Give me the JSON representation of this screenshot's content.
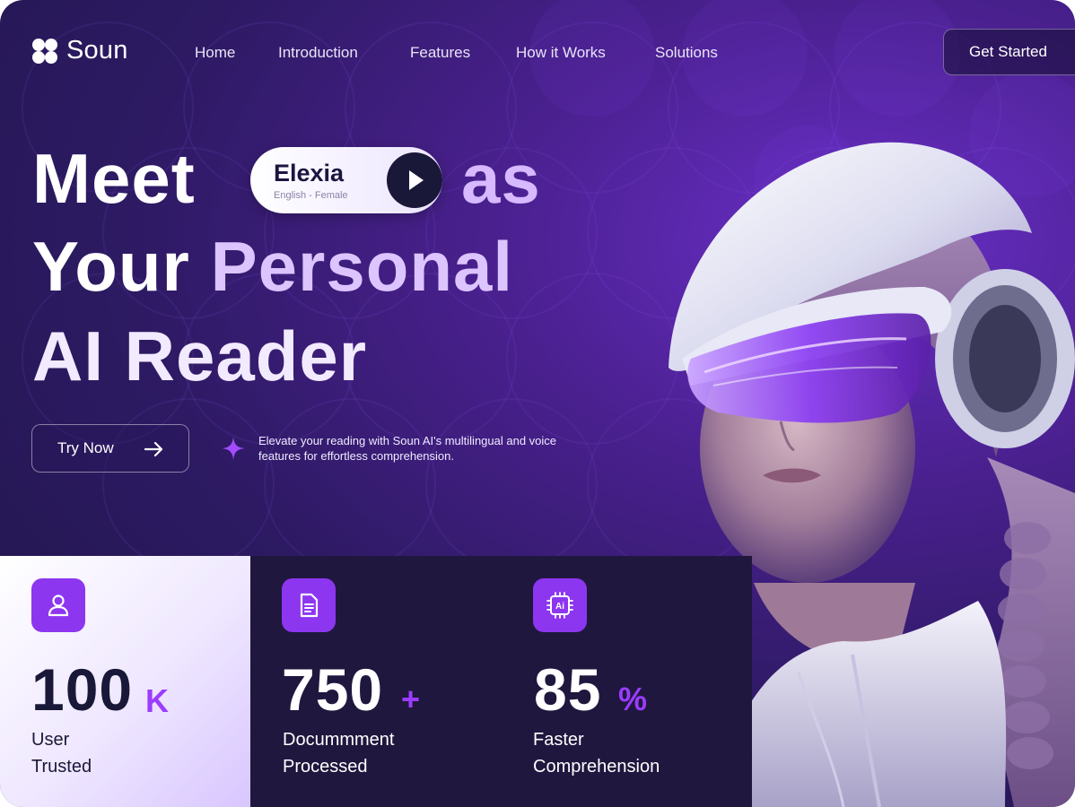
{
  "brand": {
    "name": "Soun",
    "icon": "clover-logo-icon"
  },
  "nav": {
    "items": [
      "Home",
      "Introduction",
      "Features",
      "How it Works",
      "Solutions"
    ],
    "cta_label": "Get Started"
  },
  "hero": {
    "line1_a": "Meet",
    "line1_b": "as",
    "line2_a": "Your",
    "line2_b": "Personal",
    "line3": "AI Reader",
    "voice": {
      "name": "Elexia",
      "detail": "English - Female",
      "play_icon": "play-icon"
    },
    "try_label": "Try Now",
    "try_icon": "arrow-right-icon",
    "description": "Elevate your reading with Soun AI's multilingual and voice features for effortless comprehension.",
    "description_icon": "sparkle-icon"
  },
  "stats": [
    {
      "value": "100",
      "suffix": "K",
      "label_1": "User",
      "label_2": "Trusted",
      "icon": "user-icon"
    },
    {
      "value": "750",
      "suffix": "+",
      "label_1": "Docummment",
      "label_2": "Processed",
      "icon": "document-icon"
    },
    {
      "value": "85",
      "suffix": "%",
      "label_1": "Faster",
      "label_2": "Comprehension",
      "icon": "ai-chip-icon"
    }
  ],
  "colors": {
    "accent": "#8d36f0",
    "dark": "#20173f",
    "lavender": "#d6b9ff"
  }
}
